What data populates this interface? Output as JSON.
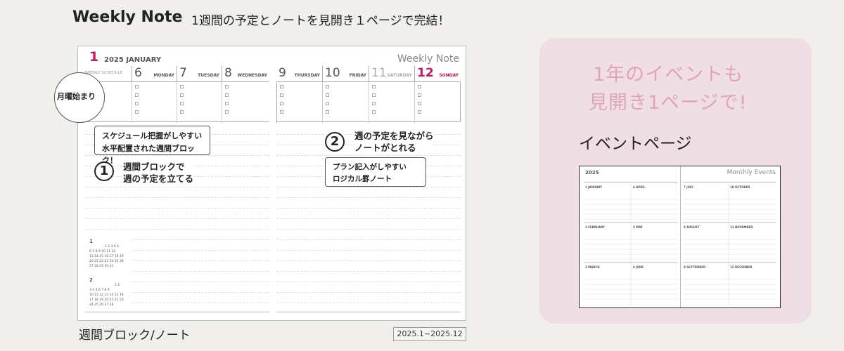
{
  "header": {
    "title": "Weekly Note",
    "subtitle": "1週間の予定とノートを見開き１ページで完結！"
  },
  "spread": {
    "month_num": "1",
    "year_month": "2025  JANUARY",
    "weekly_note": "Weekly Note",
    "schedule_label": "WEEKLY SCHEDULE",
    "left_days": [
      {
        "num": "6",
        "name": "MONDAY"
      },
      {
        "num": "7",
        "name": "TUESDAY"
      },
      {
        "num": "8",
        "name": "WEDNESDAY"
      }
    ],
    "right_days": [
      {
        "num": "9",
        "name": "THURSDAY"
      },
      {
        "num": "10",
        "name": "FRIDAY"
      },
      {
        "num": "11",
        "name": "SATURDAY"
      },
      {
        "num": "12",
        "name": "SUNDAY"
      }
    ],
    "monday_start": "月曜始まり",
    "bubble1": {
      "line1": "スケジュール把握がしやすい",
      "line2": "水平配置された週間ブロック！"
    },
    "callout1": {
      "num": "1",
      "line1": "週間ブロックで",
      "line2": "週の予定を立てる"
    },
    "callout2": {
      "num": "2",
      "line1": "週の予定を見ながら",
      "line2": "ノートがとれる"
    },
    "bubble2": {
      "line1": "プラン記入がしやすい",
      "line2": "ロジカル罫ノート"
    },
    "mini_cal_1": {
      "month": "1",
      "rows": [
        "1 2 3 4 5",
        "6 7 8 9 10 11 12",
        "13 14 15 16 17 18 19",
        "20 21 22 23 24 25 26",
        "27 28 29 30 31"
      ]
    },
    "mini_cal_2": {
      "month": "2",
      "rows": [
        "1 2",
        "3 4 5 6 7 8 9",
        "10 11 12 13 14 15 16",
        "17 18 19 20 21 22 23",
        "24 25 26 27 28"
      ]
    }
  },
  "footer": {
    "label": "週間ブロック/ノート",
    "range": "2025.1~2025.12"
  },
  "panel": {
    "headline1": "1年のイベントも",
    "headline2": "見開き1ページで!",
    "event_label": "イベントページ",
    "thumb_year": "2025",
    "thumb_title": "Monthly Events",
    "thumb_months": [
      "1 JANUARY",
      "4 APRIL",
      "7 JULY",
      "10 OCTOBER",
      "2 FEBRUARY",
      "5 MAY",
      "8 AUGUST",
      "11 NOVEMBER",
      "3 MARCH",
      "6 JUNE",
      "9 SEPTEMBER",
      "12 DECEMBER"
    ]
  },
  "colors": {
    "accent": "#c2185b",
    "panel_bg": "#efdfe4",
    "panel_text": "#e0a4b8",
    "bg": "#f1efec"
  }
}
